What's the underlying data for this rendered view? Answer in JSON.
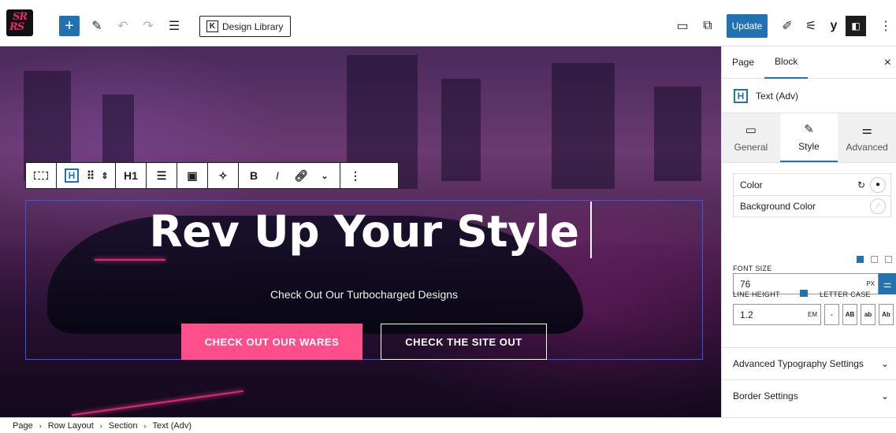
{
  "toolbar": {
    "add_icon": "plus-icon",
    "design_library_label": "Design Library",
    "update_label": "Update",
    "logo_text": "SR RS"
  },
  "block_toolbar": {
    "heading_level": "H1"
  },
  "hero": {
    "headline": "Rev Up Your Style",
    "subtitle": "Check Out Our Turbocharged Designs",
    "primary_button": "CHECK OUT OUR WARES",
    "secondary_button": "CHECK THE SITE OUT",
    "primary_color": "#ff4f8b"
  },
  "sidebar": {
    "tabs": [
      "Page",
      "Block"
    ],
    "block_name": "Text (Adv)",
    "style_tabs": [
      {
        "label": "General",
        "icon": "panel-icon"
      },
      {
        "label": "Style",
        "icon": "brush-icon"
      },
      {
        "label": "Advanced",
        "icon": "sliders-icon"
      }
    ],
    "color_label": "Color",
    "bg_color_label": "Background Color",
    "font_size_label": "FONT SIZE",
    "font_size_value": "76",
    "font_size_unit": "PX",
    "line_height_label": "LINE HEIGHT",
    "letter_case_label": "LETTER CASE",
    "line_height_value": "1.2",
    "line_height_unit": "EM",
    "letter_cases": [
      "-",
      "AB",
      "ab",
      "Ab"
    ],
    "accordions": [
      "Advanced Typography Settings",
      "Border Settings"
    ]
  },
  "breadcrumb": [
    "Page",
    "Row Layout",
    "Section",
    "Text (Adv)"
  ],
  "accent_color": "#2271b1"
}
